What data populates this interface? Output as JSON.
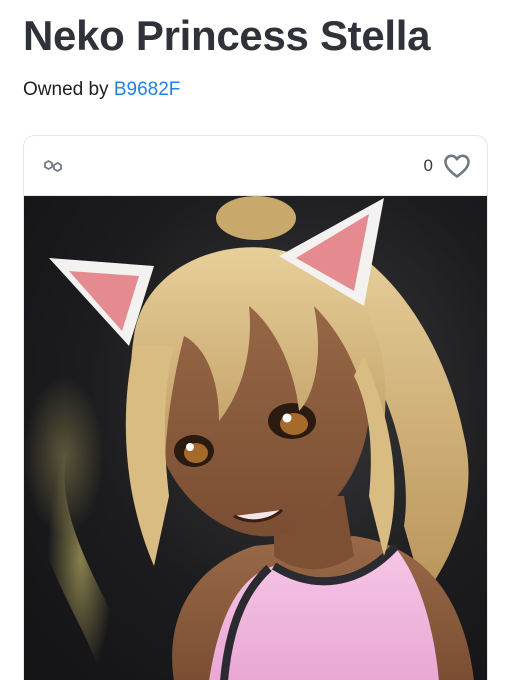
{
  "item": {
    "title": "Neko Princess Stella",
    "owned_by_prefix": "Owned by ",
    "owner_name": "B9682F"
  },
  "card": {
    "chain_icon": "polygon-chain-icon",
    "like_icon": "heart-outline-icon",
    "like_count": "0"
  },
  "image": {
    "subject": "anime catgirl artwork"
  },
  "colors": {
    "link": "#2081e2",
    "title": "#30323a",
    "border": "#e5e8eb"
  }
}
